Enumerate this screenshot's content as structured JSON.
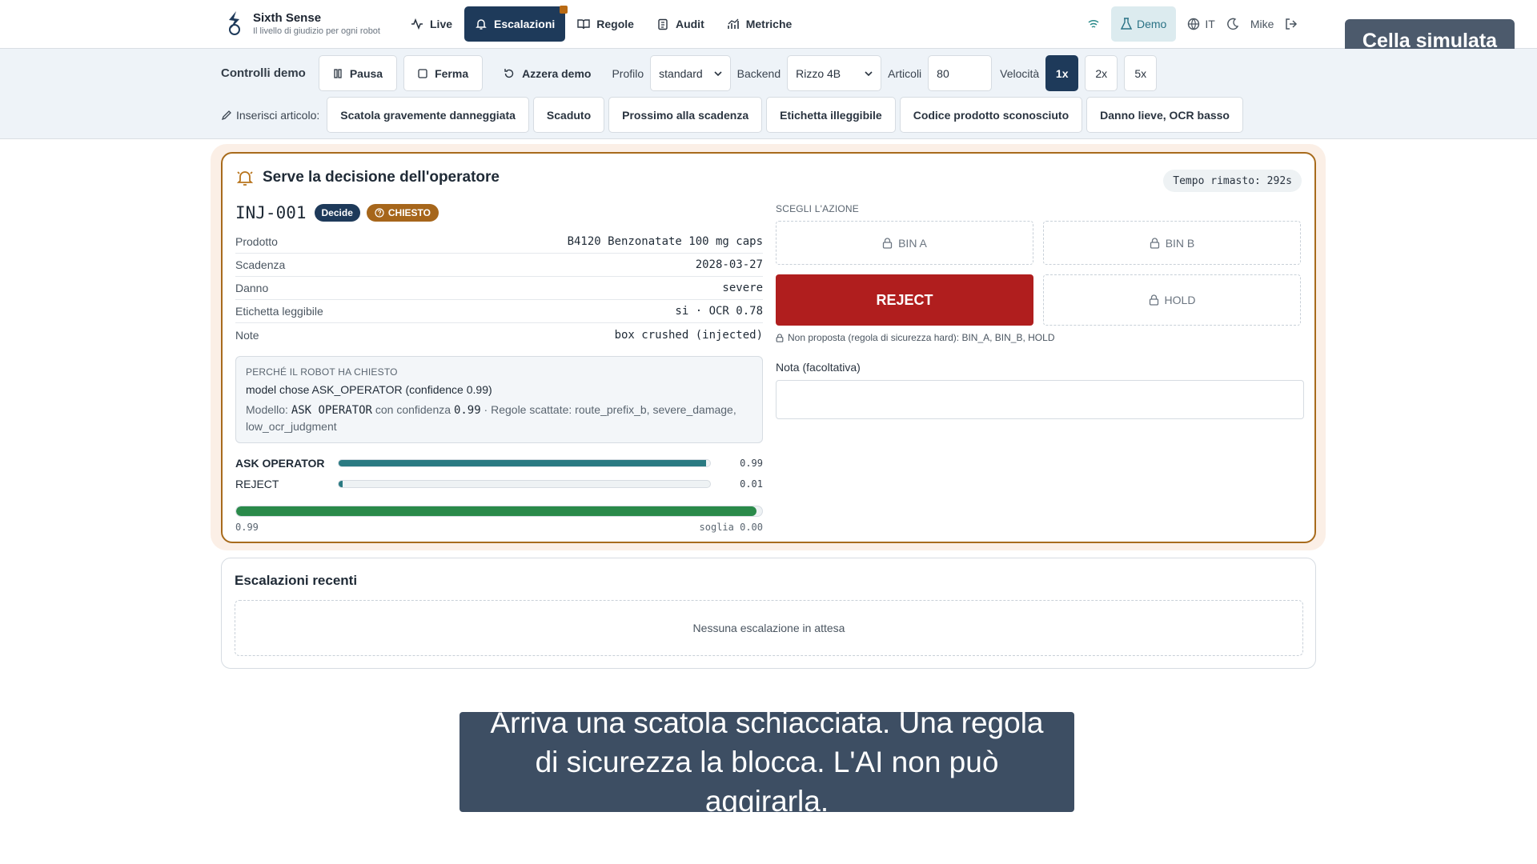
{
  "app": {
    "name": "Sixth Sense",
    "tagline": "Il livello di giudizio per ogni robot"
  },
  "nav": {
    "items": [
      {
        "label": "Live",
        "icon": "activity-icon",
        "active": false
      },
      {
        "label": "Escalazioni",
        "icon": "bell-icon",
        "active": true
      },
      {
        "label": "Regole",
        "icon": "book-icon",
        "active": false
      },
      {
        "label": "Audit",
        "icon": "clipboard-icon",
        "active": false
      },
      {
        "label": "Metriche",
        "icon": "chart-icon",
        "active": false
      }
    ],
    "demo_label": "Demo",
    "lang_label": "IT",
    "user_label": "Mike"
  },
  "sim_badge": "Cella simulata",
  "controls": {
    "title": "Controlli demo",
    "pause_label": "Pausa",
    "stop_label": "Ferma",
    "reset_label": "Azzera demo",
    "profile_label": "Profilo",
    "profile_value": "standard",
    "backend_label": "Backend",
    "backend_value": "Rizzo 4B",
    "articles_label": "Articoli",
    "articles_value": "80",
    "speed_label": "Velocità",
    "speeds": [
      "1x",
      "2x",
      "5x"
    ],
    "speed_selected": "1x",
    "inject_label": "Inserisci articolo:",
    "inject_items": [
      "Scatola gravemente danneggiata",
      "Scaduto",
      "Prossimo alla scadenza",
      "Etichetta illeggibile",
      "Codice prodotto sconosciuto",
      "Danno lieve, OCR basso"
    ]
  },
  "decision": {
    "title": "Serve la decisione dell'operatore",
    "timer": "Tempo rimasto: 292s",
    "item_id": "INJ-001",
    "badge_mode": "Decide",
    "badge_status": "CHIESTO",
    "fields": [
      {
        "key": "Prodotto",
        "value": "B4120 Benzonatate 100 mg caps"
      },
      {
        "key": "Scadenza",
        "value": "2028-03-27"
      },
      {
        "key": "Danno",
        "value": "severe"
      },
      {
        "key": "Etichetta leggibile",
        "value": "si · OCR 0.78"
      },
      {
        "key": "Note",
        "value": "box crushed (injected)"
      }
    ],
    "why": {
      "title": "PERCHÉ IL ROBOT HA CHIESTO",
      "main": "model chose ASK_OPERATOR (confidence 0.99)",
      "detail_prefix": "Modello: ",
      "detail_model": "ASK OPERATOR",
      "detail_mid": " con confidenza ",
      "detail_conf": "0.99",
      "detail_rules": " · Regole scattate: route_prefix_b, severe_damage, low_ocr_judgment"
    },
    "probabilities": [
      {
        "label": "ASK OPERATOR",
        "value": 0.99,
        "display": "0.99",
        "bold": true
      },
      {
        "label": "REJECT",
        "value": 0.01,
        "display": "0.01",
        "bold": false
      }
    ],
    "confidence": {
      "value": 0.99,
      "left_label": "0.99",
      "right_label": "soglia 0.00"
    },
    "actions_caption": "SCEGLI L'AZIONE",
    "actions": {
      "bin_a": "BIN A",
      "bin_b": "BIN B",
      "reject": "REJECT",
      "hold": "HOLD"
    },
    "safety_note": "Non proposta (regola di sicurezza hard): BIN_A, BIN_B, HOLD",
    "note_label": "Nota (facoltativa)",
    "note_value": ""
  },
  "recent": {
    "title": "Escalazioni recenti",
    "empty": "Nessuna escalazione in attesa"
  },
  "caption": "Arriva una scatola schiacciata. Una regola di sicurezza la blocca. L'AI non può aggirarla.",
  "colors": {
    "primary": "#1e3a5a",
    "amber": "#a6661b",
    "reject": "#b01e1e",
    "teal": "#2a7a82",
    "green": "#2a8a4a"
  }
}
